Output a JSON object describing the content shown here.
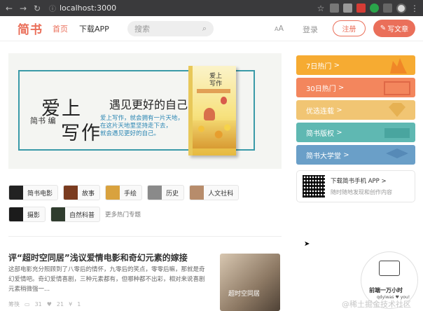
{
  "browser": {
    "url": "localhost:3000"
  },
  "header": {
    "logo": "简书",
    "nav": [
      "首页",
      "下载APP"
    ],
    "search_placeholder": "搜索",
    "font_toggle": "A",
    "font_toggle_big": "A",
    "login": "登录",
    "register": "注册",
    "write": "写文章"
  },
  "banner": {
    "title_line1": "爱上",
    "title_line2": "写作",
    "subtitle": "遇见更好的自己",
    "by": "简书 编",
    "desc": [
      "爱上写作，就会拥有一片天地，",
      "在这片天地里坚持走下去，",
      "就会遇见更好的自己。"
    ],
    "book_title": "爱上\n写作"
  },
  "topics": [
    [
      {
        "label": "简书电影",
        "color": "#222"
      },
      {
        "label": "故事",
        "color": "#7a3b1f"
      },
      {
        "label": "手绘",
        "color": "#d9a23e"
      },
      {
        "label": "历史",
        "color": "#8a8a8a"
      },
      {
        "label": "人文社科",
        "color": "#b78c6b"
      }
    ],
    [
      {
        "label": "摄影",
        "color": "#1b1b1b"
      },
      {
        "label": "自然科普",
        "color": "#2f3c2e"
      }
    ]
  ],
  "more_topics": "更多热门专题",
  "article": {
    "title": "评“超时空同居”浅议爱情电影和奇幻元素的嫁接",
    "abstract": "这部电影充分照顾到了八零后的情怀，九零后的笑点，零零后嘛，那就是奇幻爱情吧。奇幻爱情喜剧，三种元素都有，但哪种都不出彩，相对来说喜剧元素稍微强一...",
    "author": "筹筷",
    "comments": "31",
    "likes": "21",
    "money": "1",
    "thumb_text": "超时空同居"
  },
  "sidebar": {
    "boards": [
      {
        "label": "7日热门",
        "color": "#f6ab32"
      },
      {
        "label": "30日热门",
        "color": "#f3865d"
      },
      {
        "label": "优选连载",
        "color": "#f1c573"
      },
      {
        "label": "简书版权",
        "color": "#5fb8b2"
      },
      {
        "label": "简书大学堂",
        "color": "#6a9fc8"
      }
    ],
    "chevron": ">",
    "app": {
      "title": "下载简书手机 APP >",
      "desc": "随时随地发现和创作内容"
    }
  },
  "widget": {
    "title": "前端一万小时",
    "sub": "qdyiwas  ♥  you!"
  },
  "watermark": "@稀土掘金技术社区"
}
